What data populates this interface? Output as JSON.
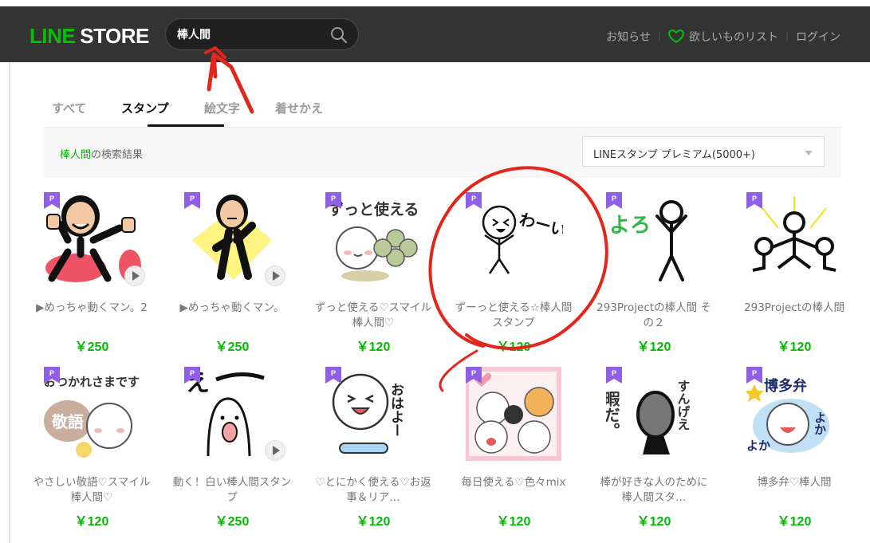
{
  "header": {
    "logo_line": "LINE",
    "logo_store": "STORE",
    "search_value": "棒人間",
    "links": [
      {
        "label": "お知らせ"
      },
      {
        "label": "欲しいものリスト"
      },
      {
        "label": "ログイン"
      }
    ],
    "accent_color": "#00c300"
  },
  "tabs": [
    {
      "label": "すべて",
      "active": false
    },
    {
      "label": "スタンプ",
      "active": true
    },
    {
      "label": "絵文字",
      "active": false
    },
    {
      "label": "着せかえ",
      "active": false
    }
  ],
  "results": {
    "keyword": "棒人間",
    "suffix": "の検索結果",
    "filter_value": "LINEスタンプ プレミアム(5000+)"
  },
  "badge_label": "P",
  "items": [
    {
      "title": "▶めっちゃ動くマン。2",
      "price": "￥250",
      "animated": true
    },
    {
      "title": "▶めっちゃ動くマン。",
      "price": "￥250",
      "animated": true
    },
    {
      "title": "ずっと使える♡スマイル棒人間♡",
      "price": "￥120",
      "animated": false
    },
    {
      "title": "ずーっと使える☆棒人間スタンプ",
      "price": "￥120",
      "animated": false
    },
    {
      "title": "293Projectの棒人間 その２",
      "price": "￥120",
      "animated": false
    },
    {
      "title": "293Projectの棒人間",
      "price": "￥120",
      "animated": false
    },
    {
      "title": "やさしい敬語♡スマイル棒人間♡",
      "price": "￥120",
      "animated": false
    },
    {
      "title": "動く！白い棒人間スタンプ",
      "price": "￥250",
      "animated": true
    },
    {
      "title": "♡とにかく使える♡お返事＆リア…",
      "price": "￥120",
      "animated": false
    },
    {
      "title": "毎日使える♡色々mix",
      "price": "￥120",
      "animated": false
    },
    {
      "title": "棒が好きな人のために 棒人間スタ…",
      "price": "￥120",
      "animated": false
    },
    {
      "title": "博多弁♡棒人間",
      "price": "￥120",
      "animated": false
    }
  ],
  "thumb_text": {
    "t3": "ずっと使える",
    "t4": "わーい!!",
    "t5": "よろ",
    "t7": "おつかれさまです",
    "t7b": "敬語",
    "t8": "え",
    "t9": "おはよー",
    "t11a": "暇だ。",
    "t11b": "すんげえ",
    "t12": "博多弁",
    "t12b": "よか"
  }
}
